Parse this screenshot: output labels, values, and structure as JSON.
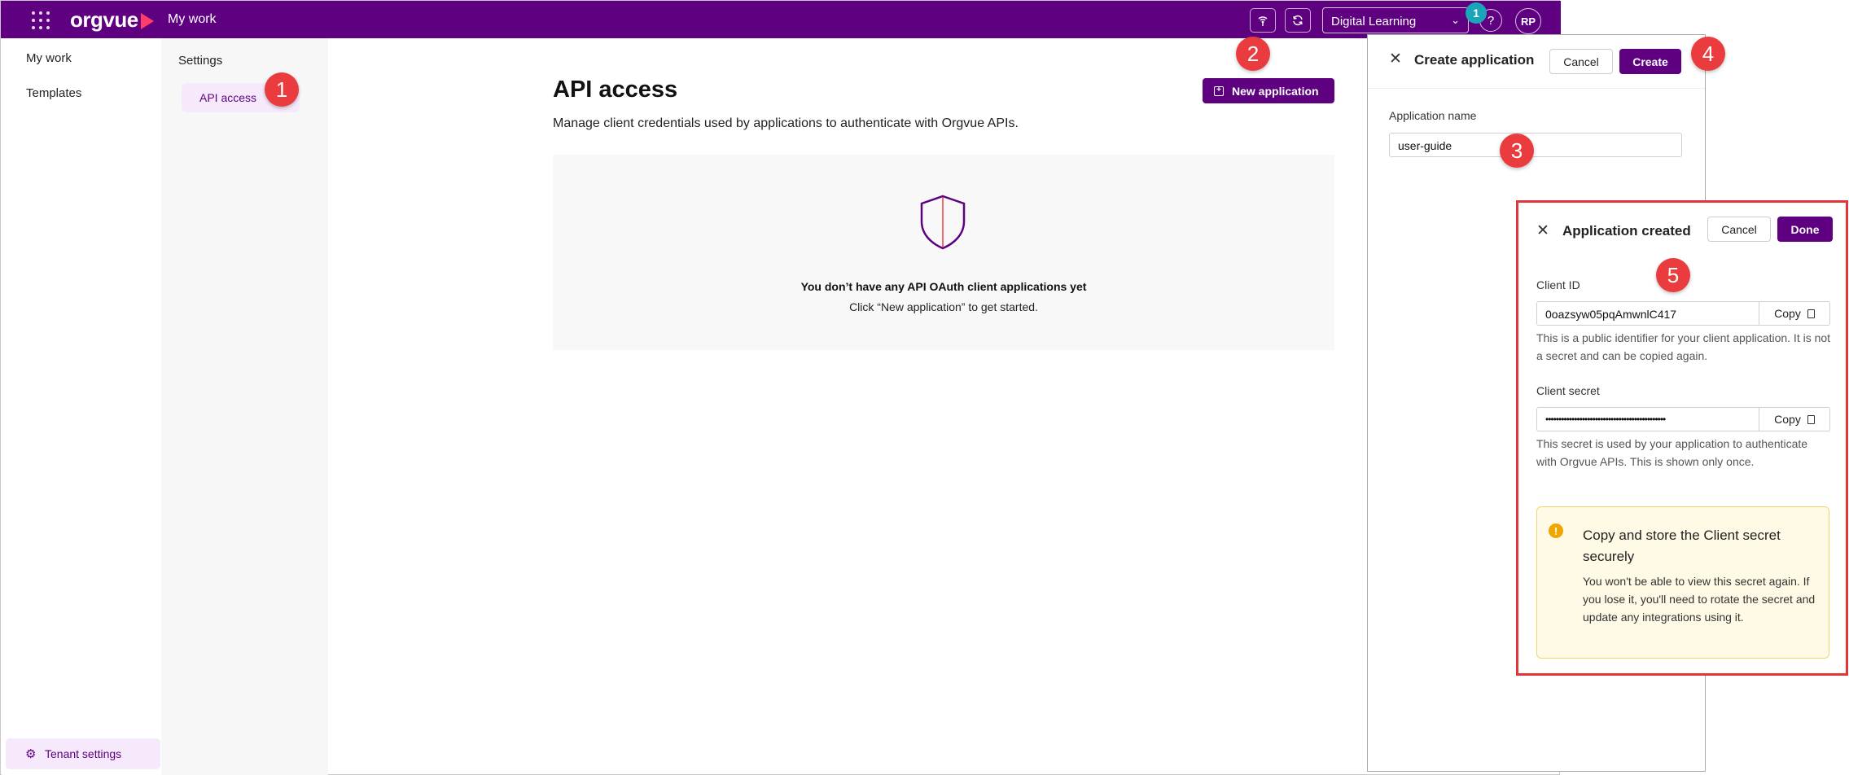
{
  "topbar": {
    "logo_text": "orgvue",
    "app_title": "My work",
    "tenant": "Digital Learning",
    "notification_count": "1",
    "help": "?",
    "avatar_initials": "RP"
  },
  "nav_primary": {
    "items": [
      {
        "label": "My work"
      },
      {
        "label": "Templates"
      }
    ],
    "footer_label": "Tenant settings"
  },
  "nav_secondary": {
    "title": "Settings",
    "items": [
      {
        "label": "API access",
        "active": true
      }
    ]
  },
  "main": {
    "title": "API access",
    "subtitle": "Manage client credentials used by applications to authenticate with Orgvue APIs.",
    "new_button": "New application",
    "empty_title": "You don’t have any API OAuth client applications yet",
    "empty_sub": "Click “New application” to get started."
  },
  "create_panel": {
    "title": "Create application",
    "cancel": "Cancel",
    "create": "Create",
    "name_label": "Application name",
    "name_value": "user-guide"
  },
  "created_panel": {
    "title": "Application created",
    "cancel": "Cancel",
    "done": "Done",
    "client_id_label": "Client ID",
    "client_id_value": "0oazsyw05pqAmwnlC417",
    "client_id_help": "This is a public identifier for your client application. It is not a secret and can be copied again.",
    "client_secret_label": "Client secret",
    "client_secret_value": "••••••••••••••••••••••••••••••••••••••••••••••",
    "client_secret_help": "This secret is used by your application to authenticate with Orgvue APIs. This is shown only once.",
    "copy": "Copy",
    "warning_title": "Copy and store the Client secret securely",
    "warning_text": "You won't be able to view this secret again. If you lose it, you'll need to rotate the secret and update any integrations using it."
  },
  "step_markers": [
    "1",
    "2",
    "3",
    "4",
    "5"
  ],
  "colors": {
    "brand": "#5e0080",
    "accent_logo": "#ff3d6b",
    "badge": "#1aa5b8",
    "step_marker": "#ea3c3f",
    "warning": "#f0a500"
  },
  "icons": [
    "apps-grid-icon",
    "signal-icon",
    "refresh-icon",
    "chevron-down-icon",
    "gear-icon",
    "plus-square-icon",
    "shield-icon",
    "close-icon",
    "copy-icon",
    "warning-icon"
  ]
}
